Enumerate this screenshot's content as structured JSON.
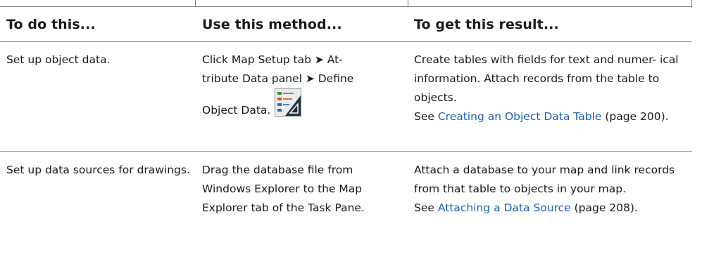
{
  "table": {
    "headers": [
      "To do this...",
      "Use this method...",
      "To get this result..."
    ],
    "rows": [
      {
        "task": "Set up object data.",
        "method_line1": "Click Map Setup tab ➤ At-",
        "method_line2": "tribute Data panel ➤ Define",
        "method_line3": "Object Data.",
        "method_icon": "define-object-data-icon",
        "result_text": "Create tables with fields for text and numer- ical information. Attach records from the table to objects.",
        "see_prefix": "See ",
        "see_link": "Creating an Object Data Table",
        "see_page": " (page 200)."
      },
      {
        "task": "Set up data sources for drawings.",
        "method_text": "Drag the database file from Windows Explorer to the Map Explorer tab of the Task Pane.",
        "result_text": "Attach a database to your map and link records from that table to objects in your map.",
        "see_prefix": "See ",
        "see_link": "Attaching a Data Source",
        "see_page": " (page 208)."
      }
    ]
  },
  "colors": {
    "link": "#1f5fb4",
    "rule": "#7f7f7f"
  }
}
